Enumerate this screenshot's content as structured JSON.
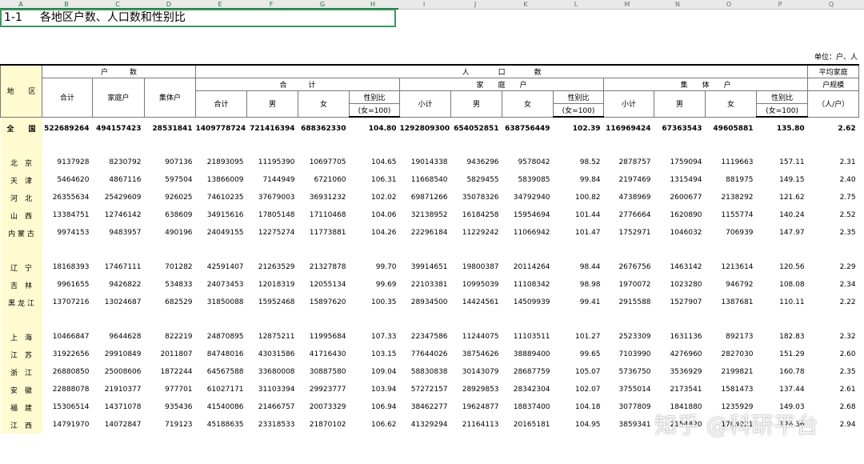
{
  "column_letters": [
    "A",
    "B",
    "C",
    "D",
    "E",
    "F",
    "G",
    "H",
    "I",
    "J",
    "K",
    "L",
    "M",
    "N",
    "O",
    "P",
    "Q"
  ],
  "title": {
    "code": "1-1",
    "text": "各地区户数、人口数和性别比"
  },
  "unit": "单位：户、人",
  "header": {
    "region": "地　　区",
    "households": "户　　　数",
    "population": "人　　　　口　　　　数",
    "total_group": "合　　　计",
    "family_group": "家　　庭　　户",
    "collective_group": "集　　体　　户",
    "avg_line1": "平均家庭",
    "avg_line2": "户规模",
    "avg_line3": "（人/户）",
    "hh_total": "合计",
    "hh_family": "家庭户",
    "hh_collective": "集体户",
    "pop_total": "合计",
    "pop_subtotal": "小计",
    "male": "男",
    "female": "女",
    "sex_ratio_line1": "性别比",
    "sex_ratio_line2": "(女=100)"
  },
  "rows": [
    {
      "type": "total",
      "region": "全　　国",
      "values": [
        "522689264",
        "494157423",
        "28531841",
        "1409778724",
        "721416394",
        "688362330",
        "104.80",
        "1292809300",
        "654052851",
        "638756449",
        "102.39",
        "116969424",
        "67363543",
        "49605881",
        "135.80",
        "2.62"
      ]
    },
    {
      "type": "gap"
    },
    {
      "type": "row",
      "region": "北　京",
      "values": [
        "9137928",
        "8230792",
        "907136",
        "21893095",
        "11195390",
        "10697705",
        "104.65",
        "19014338",
        "9436296",
        "9578042",
        "98.52",
        "2878757",
        "1759094",
        "1119663",
        "157.11",
        "2.31"
      ]
    },
    {
      "type": "row",
      "region": "天　津",
      "values": [
        "5464620",
        "4867116",
        "597504",
        "13866009",
        "7144949",
        "6721060",
        "106.31",
        "11668540",
        "5829455",
        "5839085",
        "99.84",
        "2197469",
        "1315494",
        "881975",
        "149.15",
        "2.40"
      ]
    },
    {
      "type": "row",
      "region": "河　北",
      "values": [
        "26355634",
        "25429609",
        "926025",
        "74610235",
        "37679003",
        "36931232",
        "102.02",
        "69871266",
        "35078326",
        "34792940",
        "100.82",
        "4738969",
        "2600677",
        "2138292",
        "121.62",
        "2.75"
      ]
    },
    {
      "type": "row",
      "region": "山　西",
      "values": [
        "13384751",
        "12746142",
        "638609",
        "34915616",
        "17805148",
        "17110468",
        "104.06",
        "32138952",
        "16184258",
        "15954694",
        "101.44",
        "2776664",
        "1620890",
        "1155774",
        "140.24",
        "2.52"
      ]
    },
    {
      "type": "row",
      "region": "内 蒙 古",
      "values": [
        "9974153",
        "9483957",
        "490196",
        "24049155",
        "12275274",
        "11773881",
        "104.26",
        "22296184",
        "11229242",
        "11066942",
        "101.47",
        "1752971",
        "1046032",
        "706939",
        "147.97",
        "2.35"
      ]
    },
    {
      "type": "gapbig"
    },
    {
      "type": "row",
      "region": "辽　宁",
      "values": [
        "18168393",
        "17467111",
        "701282",
        "42591407",
        "21263529",
        "21327878",
        "99.70",
        "39914651",
        "19800387",
        "20114264",
        "98.44",
        "2676756",
        "1463142",
        "1213614",
        "120.56",
        "2.29"
      ]
    },
    {
      "type": "row",
      "region": "吉　林",
      "values": [
        "9961655",
        "9426822",
        "534833",
        "24073453",
        "12018319",
        "12055134",
        "99.69",
        "22103381",
        "10995039",
        "11108342",
        "98.98",
        "1970072",
        "1023280",
        "946792",
        "108.08",
        "2.34"
      ]
    },
    {
      "type": "row",
      "region": "黑 龙 江",
      "values": [
        "13707216",
        "13024687",
        "682529",
        "31850088",
        "15952468",
        "15897620",
        "100.35",
        "28934500",
        "14424561",
        "14509939",
        "99.41",
        "2915588",
        "1527907",
        "1387681",
        "110.11",
        "2.22"
      ]
    },
    {
      "type": "gapbig"
    },
    {
      "type": "row",
      "region": "上　海",
      "values": [
        "10466847",
        "9644628",
        "822219",
        "24870895",
        "12875211",
        "11995684",
        "107.33",
        "22347586",
        "11244075",
        "11103511",
        "101.27",
        "2523309",
        "1631136",
        "892173",
        "182.83",
        "2.32"
      ]
    },
    {
      "type": "row",
      "region": "江　苏",
      "values": [
        "31922656",
        "29910849",
        "2011807",
        "84748016",
        "43031586",
        "41716430",
        "103.15",
        "77644026",
        "38754626",
        "38889400",
        "99.65",
        "7103990",
        "4276960",
        "2827030",
        "151.29",
        "2.60"
      ]
    },
    {
      "type": "row",
      "region": "浙　江",
      "values": [
        "26880850",
        "25008606",
        "1872244",
        "64567588",
        "33680008",
        "30887580",
        "109.04",
        "58830838",
        "30143079",
        "28687759",
        "105.07",
        "5736750",
        "3536929",
        "2199821",
        "160.78",
        "2.35"
      ]
    },
    {
      "type": "row",
      "region": "安　徽",
      "values": [
        "22888078",
        "21910377",
        "977701",
        "61027171",
        "31103394",
        "29923777",
        "103.94",
        "57272157",
        "28929853",
        "28342304",
        "102.07",
        "3755014",
        "2173541",
        "1581473",
        "137.44",
        "2.61"
      ]
    },
    {
      "type": "row",
      "region": "福　建",
      "values": [
        "15306514",
        "14371078",
        "935436",
        "41540086",
        "21466757",
        "20073329",
        "106.94",
        "38462277",
        "19624877",
        "18837400",
        "104.18",
        "3077809",
        "1841880",
        "1235929",
        "149.03",
        "2.68"
      ]
    },
    {
      "type": "row",
      "region": "江　西",
      "values": [
        "14791970",
        "14072847",
        "719123",
        "45188635",
        "23318533",
        "21870102",
        "106.62",
        "41329294",
        "21164113",
        "20165181",
        "104.95",
        "3859341",
        "2154420",
        "1704921",
        "126.36",
        "2.94"
      ]
    }
  ],
  "watermark": "知乎 @科研平台"
}
